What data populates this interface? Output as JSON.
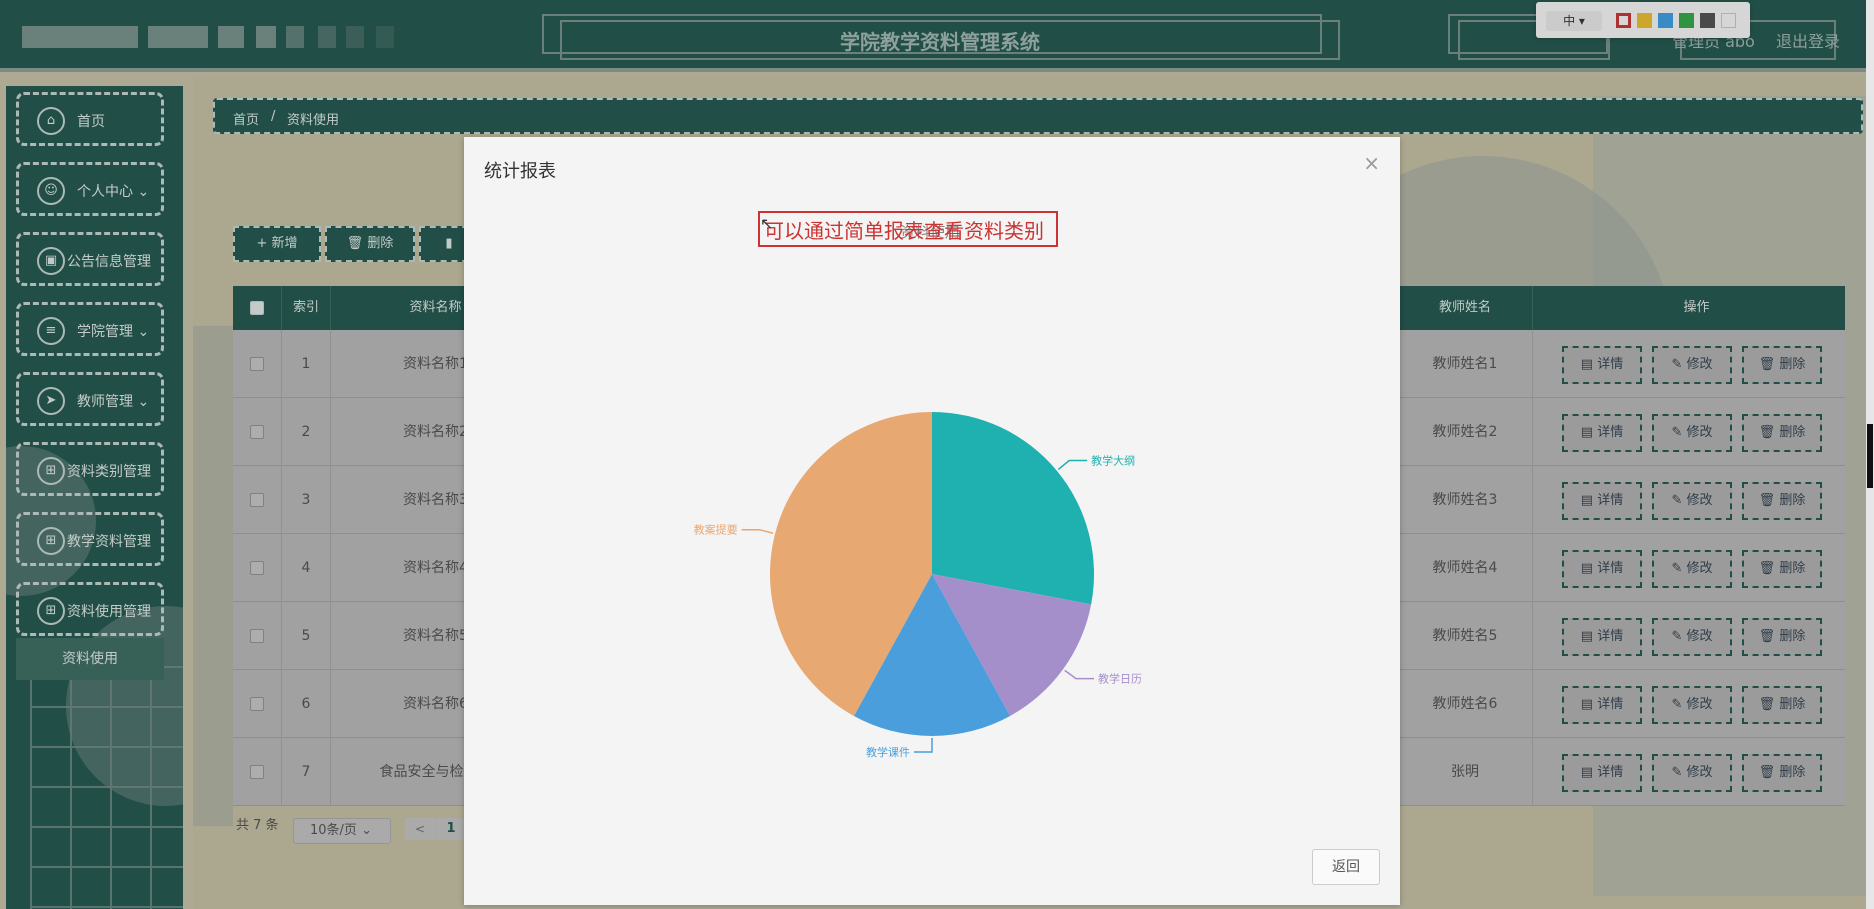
{
  "header": {
    "title": "学院教学资料管理系统",
    "admin_label": "管理员 abo",
    "logout_label": "退出登录"
  },
  "float_toolbar": {
    "size_select": "中",
    "colors": [
      "#cc2222",
      "#f2c019",
      "#2d9be8",
      "#21a63a",
      "#444444",
      "#ffffff"
    ]
  },
  "sidebar": {
    "items": [
      {
        "label": "首页",
        "icon": "home-icon",
        "glyph": "⌂"
      },
      {
        "label": "个人中心",
        "icon": "user-icon",
        "glyph": "☺"
      },
      {
        "label": "公告信息管理",
        "icon": "notice-icon",
        "glyph": "▣"
      },
      {
        "label": "学院管理",
        "icon": "sliders-icon",
        "glyph": "≡"
      },
      {
        "label": "教师管理",
        "icon": "send-icon",
        "glyph": "➤"
      },
      {
        "label": "资料类别管理",
        "icon": "grid-icon",
        "glyph": "⊞"
      },
      {
        "label": "教学资料管理",
        "icon": "grid-icon",
        "glyph": "⊞"
      },
      {
        "label": "资料使用管理",
        "icon": "grid-icon",
        "glyph": "⊞"
      }
    ],
    "submenu_active": "资料使用"
  },
  "breadcrumb": {
    "home": "首页",
    "separator": "/",
    "current": "资料使用"
  },
  "toolbar": {
    "add_label": "+ 新增",
    "delete_label": "删除"
  },
  "table": {
    "headers": {
      "index": "索引",
      "name": "资料名称",
      "teacher": "教师姓名",
      "action": "操作"
    },
    "rows": [
      {
        "index": "1",
        "name": "资料名称1",
        "teacher": "教师姓名1"
      },
      {
        "index": "2",
        "name": "资料名称2",
        "teacher": "教师姓名2"
      },
      {
        "index": "3",
        "name": "资料名称3",
        "teacher": "教师姓名3"
      },
      {
        "index": "4",
        "name": "资料名称4",
        "teacher": "教师姓名4"
      },
      {
        "index": "5",
        "name": "资料名称5",
        "teacher": "教师姓名5"
      },
      {
        "index": "6",
        "name": "资料名称6",
        "teacher": "教师姓名6"
      },
      {
        "index": "7",
        "name": "食品安全与检验课",
        "teacher": "张明"
      }
    ],
    "actions": {
      "detail": "详情",
      "edit": "修改",
      "delete": "删除"
    }
  },
  "pagination": {
    "total": "共 7 条",
    "page_size": "10条/页",
    "prev": "<",
    "current_page": "1"
  },
  "dialog": {
    "title": "统计报表",
    "close": "×",
    "annotation": "可以通过简单报表查看资料类别",
    "chart_title_ghost": "资料使用",
    "back_label": "返回"
  },
  "chart_data": {
    "type": "pie",
    "title": "资料使用",
    "slices": [
      {
        "name": "教学大纲",
        "value": 28,
        "color": "#1fb0b0"
      },
      {
        "name": "教学日历",
        "value": 14,
        "color": "#a58fcb"
      },
      {
        "name": "教学课件",
        "value": 16,
        "color": "#4a9edb"
      },
      {
        "name": "教案提要",
        "value": 42,
        "color": "#e8a872"
      }
    ]
  }
}
